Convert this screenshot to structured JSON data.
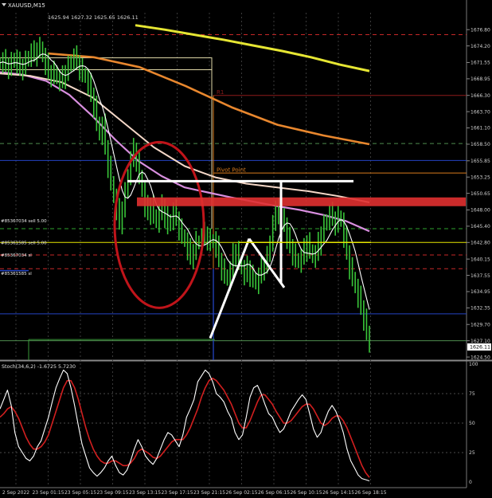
{
  "header": {
    "symbol": "XAUUSD,M15",
    "ohlc": "1625.94 1627.32 1625.65 1626.11"
  },
  "chart_data": [
    {
      "type": "candlestick-line",
      "title": "XAUUSD,M15",
      "ylim": [
        1624.0,
        1679.5
      ],
      "y_ticks": [
        "1676.80",
        "1674.20",
        "1671.55",
        "1668.95",
        "1666.30",
        "1663.70",
        "1661.10",
        "1658.50",
        "1655.85",
        "1653.25",
        "1650.65",
        "1648.00",
        "1645.40",
        "1642.80",
        "1640.15",
        "1637.55",
        "1634.95",
        "1632.35",
        "1629.70",
        "1627.10",
        "1624.50"
      ],
      "x_ticks": [
        "2 Sep 2022",
        "23 Sep 01:15",
        "23 Sep 05:15",
        "23 Sep 09:15",
        "23 Sep 13:15",
        "23 Sep 17:15",
        "23 Sep 21:15",
        "26 Sep 02:15",
        "26 Sep 06:15",
        "26 Sep 10:15",
        "26 Sep 14:15",
        "26 Sep 18:15"
      ],
      "current_price": "1626.11",
      "price": [
        1671.5,
        1671.8,
        1671.2,
        1670.8,
        1671.6,
        1672.2,
        1671.4,
        1670.6,
        1671.0,
        1671.8,
        1672.5,
        1673.2,
        1672.8,
        1673.6,
        1674.0,
        1672.5,
        1671.2,
        1670.0,
        1669.5,
        1670.2,
        1669.0,
        1668.6,
        1669.2,
        1670.0,
        1671.0,
        1671.8,
        1672.4,
        1671.6,
        1670.6,
        1669.8,
        1669.2,
        1668.0,
        1666.4,
        1664.6,
        1662.0,
        1660.0,
        1661.5,
        1658.0,
        1655.0,
        1652.5,
        1650.0,
        1648.0,
        1646.0,
        1648.2,
        1650.8,
        1653.6,
        1656.0,
        1657.6,
        1656.0,
        1653.5,
        1651.0,
        1648.5,
        1647.5,
        1648.8,
        1647.2,
        1646.0,
        1647.5,
        1648.6,
        1647.0,
        1645.5,
        1646.4,
        1647.8,
        1646.6,
        1645.0,
        1644.0,
        1643.0,
        1641.6,
        1640.4,
        1641.4,
        1643.0,
        1642.6,
        1643.6,
        1644.2,
        1643.4,
        1642.8,
        1643.2,
        1642.0,
        1640.0,
        1638.6,
        1637.6,
        1636.8,
        1638.4,
        1640.8,
        1641.4,
        1639.8,
        1638.6,
        1637.6,
        1638.8,
        1637.6,
        1637.0,
        1636.2,
        1637.4,
        1638.6,
        1639.2,
        1640.6,
        1643.0,
        1645.8,
        1647.6,
        1648.8,
        1647.4,
        1645.4,
        1643.4,
        1642.2,
        1641.0,
        1640.2,
        1639.6,
        1640.4,
        1641.6,
        1642.8,
        1641.6,
        1640.4,
        1641.0,
        1642.6,
        1644.2,
        1645.6,
        1646.4,
        1647.4,
        1646.6,
        1645.8,
        1647.0,
        1646.2,
        1643.6,
        1641.2,
        1638.8,
        1637.2,
        1635.6,
        1634.0,
        1632.4,
        1630.6,
        1628.6,
        1626.1
      ],
      "sma_slow": [
        1677.5,
        1676.8,
        1676.0,
        1675.2,
        1674.3,
        1673.4,
        1672.4,
        1671.2,
        1670.2
      ],
      "sma_orange": [
        1673.0,
        1672.4,
        1670.8,
        1667.8,
        1664.4,
        1661.6,
        1659.9,
        1658.5
      ],
      "sma_pink": [
        1670.0,
        1669.6,
        1668.6,
        1666.4,
        1663.0,
        1659.2,
        1655.8,
        1653.4,
        1651.6,
        1650.8,
        1650.0,
        1649.3,
        1648.6,
        1648.0,
        1647.2,
        1646.2,
        1644.6
      ],
      "sma_cream": [
        1669.8,
        1669.4,
        1668.4,
        1666.0,
        1662.0,
        1658.0,
        1655.0,
        1653.2,
        1652.2,
        1651.6,
        1651.0,
        1650.2,
        1649.2
      ],
      "hlines": [
        {
          "price": 1676.0,
          "color": "#c62828",
          "style": "dash"
        },
        {
          "price": 1666.3,
          "color": "#8e1b1b",
          "style": "solid",
          "label": "R1"
        },
        {
          "price": 1658.6,
          "color": "#4e8c4e",
          "style": "dash"
        },
        {
          "price": 1655.9,
          "color": "#2443c2",
          "style": "solid"
        },
        {
          "price": 1653.9,
          "color": "#d87a1c",
          "style": "solid",
          "label": "Pivot Point"
        },
        {
          "price": 1645.0,
          "color": "#2ea32e",
          "style": "dash"
        },
        {
          "price": 1642.8,
          "color": "#e6e600",
          "style": "solid"
        },
        {
          "price": 1640.8,
          "color": "#c62828",
          "style": "dash"
        },
        {
          "price": 1638.6,
          "color": "#c62828",
          "style": "dash"
        },
        {
          "price": 1631.4,
          "color": "#2443c2",
          "style": "solid"
        },
        {
          "price": 1627.1,
          "color": "#4e8c4e",
          "style": "solid"
        }
      ],
      "order_labels": [
        {
          "text": "#85367034 sell 5.00",
          "price": 1646.3
        },
        {
          "text": "#85361585 sell 5.00",
          "price": 1642.8
        },
        {
          "text": "#85367034 sl",
          "price": 1640.8
        },
        {
          "text": "#85361585 sl",
          "price": 1637.9
        }
      ],
      "annotations": [
        {
          "type": "ellipse",
          "color": "#c0141a"
        },
        {
          "type": "rectangle-band",
          "color": "#e03030",
          "from": 1648.6,
          "to": 1650.0
        },
        {
          "type": "line",
          "color": "#ffffff",
          "label": "white trend lines"
        }
      ]
    },
    {
      "type": "line",
      "title": "Stoch(34,6,2) -1.6725 5.7230",
      "ylim": [
        0,
        100
      ],
      "y_ticks": [
        "100",
        "75",
        "50",
        "25",
        "0"
      ],
      "main_k": [
        62,
        70,
        78,
        65,
        42,
        30,
        25,
        20,
        18,
        22,
        30,
        35,
        45,
        55,
        68,
        80,
        88,
        95,
        92,
        80,
        65,
        48,
        32,
        22,
        12,
        8,
        5,
        8,
        12,
        18,
        22,
        14,
        8,
        6,
        10,
        18,
        28,
        36,
        30,
        22,
        18,
        15,
        20,
        28,
        36,
        42,
        40,
        35,
        30,
        40,
        55,
        62,
        70,
        85,
        90,
        95,
        92,
        85,
        75,
        72,
        68,
        60,
        54,
        42,
        36,
        40,
        55,
        72,
        80,
        82,
        75,
        66,
        58,
        55,
        48,
        42,
        45,
        52,
        60,
        65,
        70,
        74,
        70,
        58,
        45,
        38,
        42,
        52,
        60,
        65,
        60,
        52,
        42,
        28,
        18,
        12,
        6,
        3,
        2,
        1
      ],
      "signal_d": [
        55,
        58,
        62,
        64,
        60,
        54,
        46,
        38,
        32,
        28,
        28,
        30,
        34,
        40,
        50,
        60,
        70,
        80,
        86,
        86,
        80,
        70,
        58,
        46,
        36,
        28,
        22,
        18,
        16,
        16,
        18,
        18,
        16,
        14,
        14,
        16,
        20,
        26,
        28,
        26,
        24,
        21,
        20,
        22,
        26,
        30,
        34,
        36,
        36,
        36,
        40,
        46,
        54,
        62,
        72,
        80,
        86,
        88,
        86,
        82,
        78,
        72,
        66,
        58,
        50,
        46,
        46,
        52,
        60,
        68,
        74,
        74,
        70,
        66,
        60,
        55,
        50,
        50,
        52,
        56,
        60,
        64,
        66,
        66,
        62,
        56,
        50,
        48,
        50,
        54,
        56,
        56,
        52,
        46,
        38,
        30,
        22,
        14,
        8,
        4
      ],
      "labels": {
        "stoch_title": "Stoch(34,6,2) -1.6725 5.7230"
      }
    }
  ]
}
